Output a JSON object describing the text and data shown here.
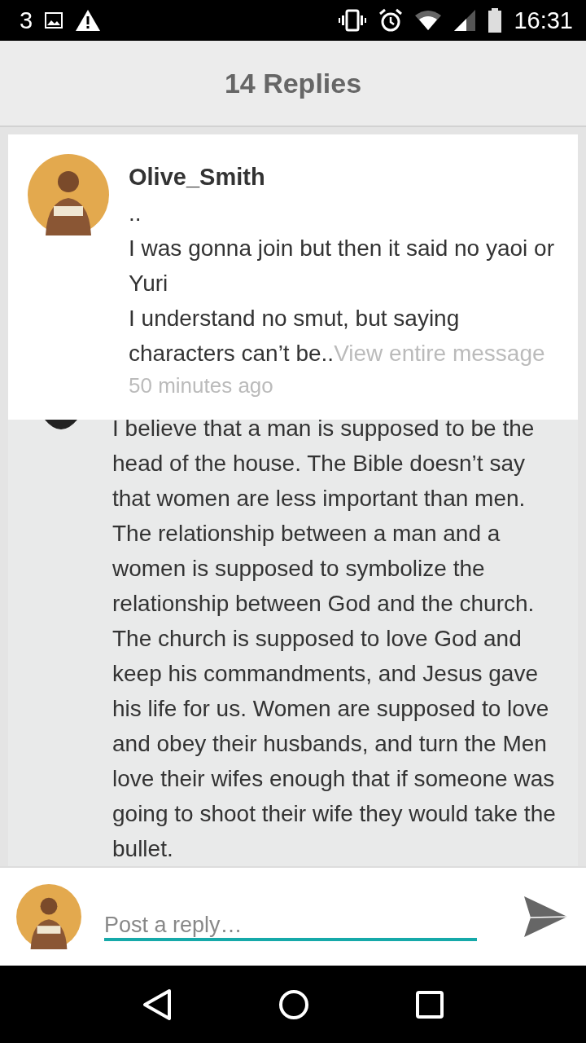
{
  "status_bar": {
    "notification_count": "3",
    "time": "16:31"
  },
  "header": {
    "title": "14 Replies"
  },
  "post": {
    "author": "Olive_Smith",
    "message": "..\nI was gonna join but then it said no yaoi or Yuri\nI understand no smut, but saying characters can’t be..",
    "more_link": "View entire message",
    "time": "50 minutes ago"
  },
  "reply": {
    "text": "I believe that a man is supposed to be the head of the house. The Bible doesn’t say that women are less important than men. The relationship between a man and a women is supposed to symbolize the relationship between God and the church. The church is supposed to love God and keep his commandments, and Jesus gave his life for us. Women are supposed to love and obey their husbands, and turn the Men love their wifes enough that if someone was going to shoot their wife they would take the bullet."
  },
  "composer": {
    "placeholder": "Post a reply…"
  }
}
